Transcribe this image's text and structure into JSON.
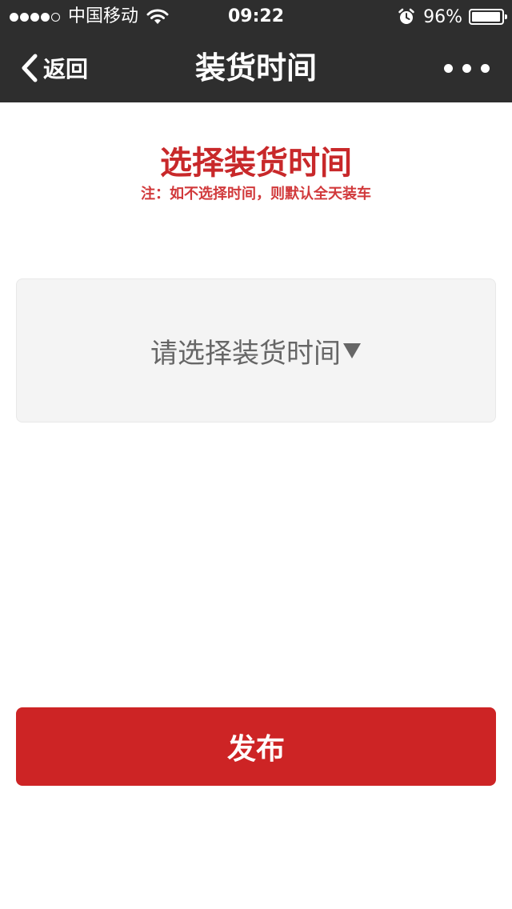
{
  "status_bar": {
    "signal_filled": 4,
    "signal_total": 5,
    "carrier": "中国移动",
    "wifi_icon": "wifi-icon",
    "time": "09:22",
    "alarm_icon": "alarm-clock-icon",
    "battery_percent_text": "96%",
    "battery_level": 0.96
  },
  "nav": {
    "back_icon": "chevron-left-icon",
    "back_label": "返回",
    "title": "装货时间",
    "more_icon": "more-horizontal-icon"
  },
  "main": {
    "heading": "选择装货时间",
    "note": "注：如不选择时间，则默认全天装车",
    "time_select": {
      "label": "请选择装货时间",
      "caret_icon": "triangle-down-icon"
    },
    "publish_label": "发布"
  },
  "colors": {
    "bar_background": "#2e2e2e",
    "accent_red": "#cd2425",
    "heading_red": "#c8282a",
    "select_background": "#f4f4f4"
  }
}
